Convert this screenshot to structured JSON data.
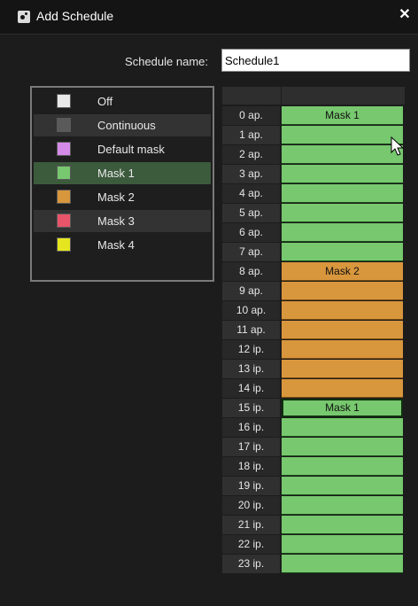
{
  "window": {
    "title": "Add Schedule",
    "close_glyph": "✕"
  },
  "schedule_name": {
    "label": "Schedule name:",
    "value": "Schedule1"
  },
  "legend": {
    "items": [
      {
        "label": "Off",
        "color": "#e8e8e8"
      },
      {
        "label": "Continuous",
        "color": "#5a5a5a"
      },
      {
        "label": "Default mask",
        "color": "#d48be8"
      },
      {
        "label": "Mask 1",
        "color": "#77c86e"
      },
      {
        "label": "Mask 2",
        "color": "#d8963d"
      },
      {
        "label": "Mask 3",
        "color": "#e8546a"
      },
      {
        "label": "Mask 4",
        "color": "#e6e620"
      }
    ],
    "selected": "Mask 1"
  },
  "grid": {
    "hours": [
      "0 ap.",
      "1 ap.",
      "2 ap.",
      "3 ap.",
      "4 ap.",
      "5 ap.",
      "6 ap.",
      "7 ap.",
      "8 ap.",
      "9 ap.",
      "10 ap.",
      "11 ap.",
      "12 ip.",
      "13 ip.",
      "14 ip.",
      "15 ip.",
      "16 ip.",
      "17 ip.",
      "18 ip.",
      "19 ip.",
      "20 ip.",
      "21 ip.",
      "22 ip.",
      "23 ip."
    ],
    "slots": [
      "Mask 1",
      "Mask 1",
      "Mask 1",
      "Mask 1",
      "Mask 1",
      "Mask 1",
      "Mask 1",
      "Mask 1",
      "Mask 2",
      "Mask 2",
      "Mask 2",
      "Mask 2",
      "Mask 2",
      "Mask 2",
      "Mask 2",
      "Mask 1",
      "Mask 1",
      "Mask 1",
      "Mask 1",
      "Mask 1",
      "Mask 1",
      "Mask 1",
      "Mask 1",
      "Mask 1"
    ],
    "labels": [
      {
        "text": "Mask 1"
      },
      {
        "text": "Mask 2"
      },
      {
        "text": "Mask 1"
      }
    ]
  },
  "icons": {
    "title_icon": "schedule-settings-icon",
    "close": "close-icon",
    "cursor": "mouse-pointer-icon"
  }
}
